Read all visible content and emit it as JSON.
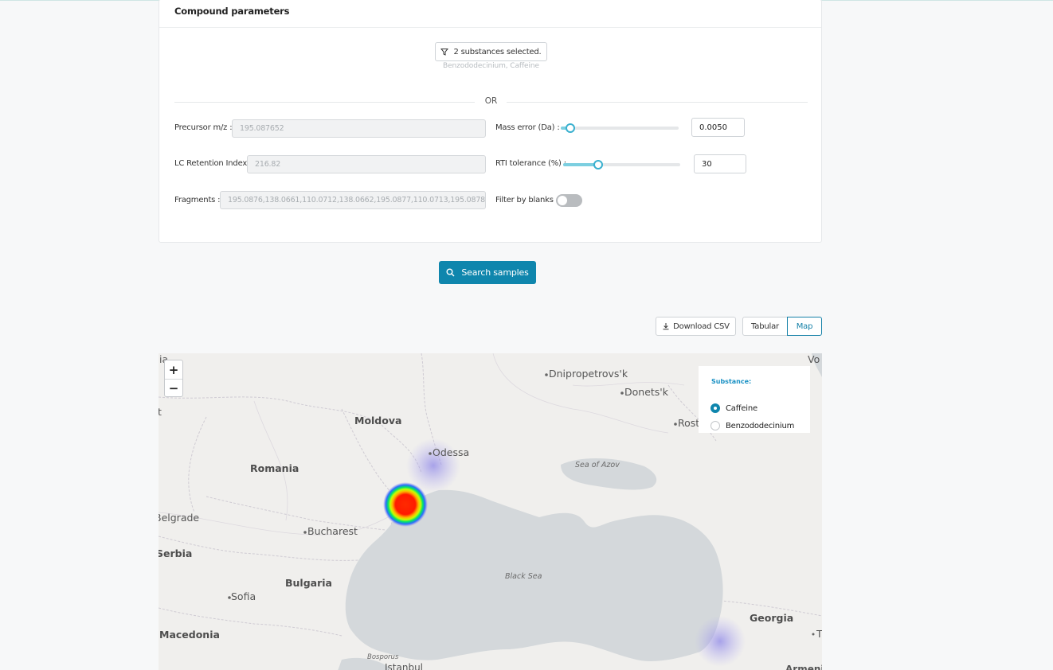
{
  "compound": {
    "title": "Compound parameters",
    "substances_button": "2 substances selected.",
    "substances_list": "Benzododecinium, Caffeine",
    "or_label": "OR",
    "precursor_label": "Precursor m/z :",
    "precursor_value": "195.087652",
    "lc_label": "LC Retention Index :",
    "lc_value": "216.82",
    "fragments_label": "Fragments :",
    "fragments_value": "195.0876,138.0661,110.0712,138.0662,195.0877,110.0713,195.0878",
    "mass_error_label": "Mass error (Da) :",
    "mass_error_value": "0.0050",
    "mass_error_level": 0.08,
    "rti_label": "RTI tolerance (%) :",
    "rti_value": "30",
    "rti_level": 0.3,
    "blanks_label": "Filter by blanks :",
    "blanks_on": false
  },
  "actions": {
    "search_label": "Search samples",
    "download_label": "Download CSV",
    "tabular_label": "Tabular",
    "map_label": "Map"
  },
  "map": {
    "zoom_in": "+",
    "zoom_out": "−",
    "legend_title": "Substance:",
    "substances": [
      {
        "label": "Caffeine",
        "selected": true
      },
      {
        "label": "Benzododecinium",
        "selected": false
      }
    ],
    "places": {
      "moldova": "Moldova",
      "romania": "Romania",
      "bulgaria": "Bulgaria",
      "georgia": "Georgia",
      "macedonia": "Macedonia",
      "serbia": "Serbia",
      "odessa": "Odessa",
      "bucharest": "Bucharest",
      "sofia": "Sofia",
      "belgrade": "Belgrade",
      "dnipro": "Dnipropetrovs'k",
      "donetsk": "Donets'k",
      "rost": "Rost",
      "vo": "Vo",
      "ia": "ia",
      "t_left": "t",
      "t_right": "T",
      "istanbul": "Istanbul",
      "armenia": "Armeni",
      "sea_azov": "Sea of Azov",
      "black_sea": "Black Sea",
      "bosporus": "Bosporus"
    },
    "accent_color": "#0f86ad"
  }
}
